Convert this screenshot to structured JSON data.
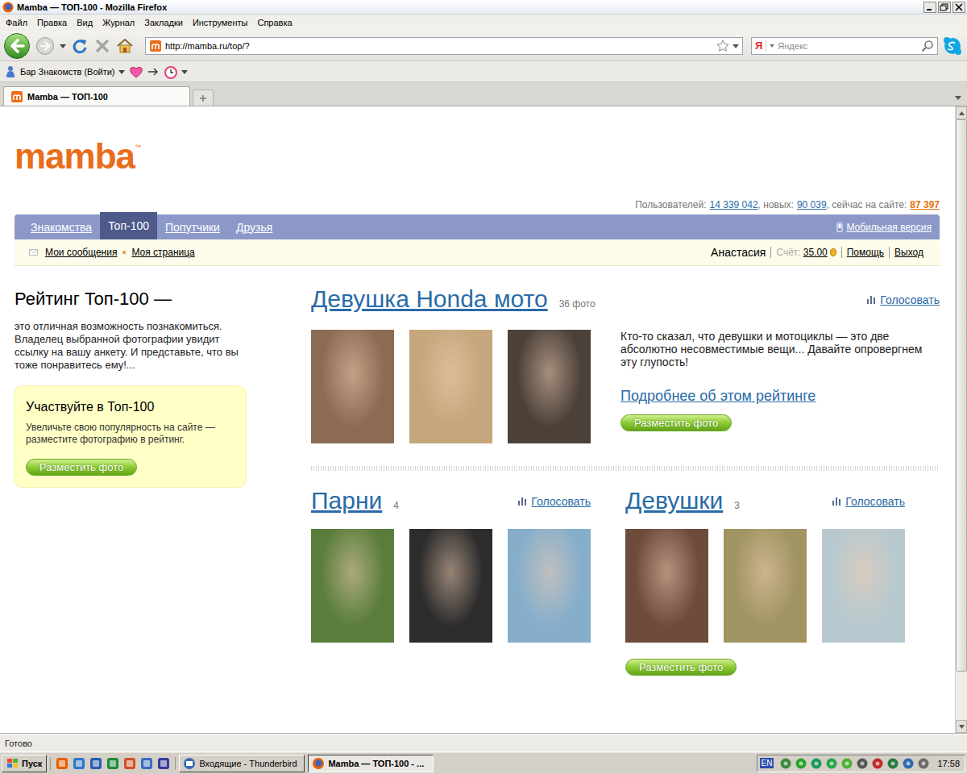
{
  "window": {
    "title": "Mamba — ТОП-100 - Mozilla Firefox"
  },
  "menu": [
    "Файл",
    "Правка",
    "Вид",
    "Журнал",
    "Закладки",
    "Инструменты",
    "Справка"
  ],
  "toolbar": {
    "url": "http://mamba.ru/top/?",
    "search_logo": "Я",
    "search_placeholder": "Яндекс"
  },
  "bookmarks": [
    {
      "label": "Бар Знакомств (Войти)"
    }
  ],
  "tabs": [
    {
      "label": "Mamba — ТОП-100",
      "selected": true
    }
  ],
  "page": {
    "logo": "mamba",
    "logo_tm": "™",
    "stats": [
      {
        "label": "Пользователей:",
        "value": "14 339 042",
        "highlight": false
      },
      {
        "label": ", новых:",
        "value": "90 039",
        "highlight": false
      },
      {
        "label": ", сейчас на сайте:",
        "value": "87 397",
        "highlight": true
      }
    ],
    "nav": [
      {
        "label": "Знакомства",
        "selected": false
      },
      {
        "label": "Топ-100",
        "selected": true
      },
      {
        "label": "Попутчики",
        "selected": false
      },
      {
        "label": "Друзья",
        "selected": false
      }
    ],
    "mobile": "Мобильная версия",
    "subnav": {
      "links": [
        "Мои сообщения",
        "Моя страница"
      ],
      "user": "Анастасия",
      "balance_label": "Счёт:",
      "balance": "35.00",
      "actions": [
        "Помощь",
        "Выход"
      ]
    },
    "sidebar": {
      "title": "Рейтинг Топ-100 —",
      "text": "это отличная возможность познакомиться. Владелец выбранной фотографии увидит ссылку на вашу анкету. И представьте, что вы тоже понравитесь ему!...",
      "promo": {
        "title": "Участвуйте в Топ-100",
        "text": "Увеличьте свою популярность на сайте — разместите фотографию в рейтинг.",
        "button": "Разместить фото"
      }
    },
    "featured": {
      "title": "Девушка Honda мото",
      "count": "36 фото",
      "vote": "Голосовать",
      "photos": [
        {
          "color": "#8b6b54"
        },
        {
          "color": "#c6a67c"
        },
        {
          "color": "#4b4139"
        }
      ],
      "description": "Кто-то сказал, что девушки и мотоциклы — это две абсолютно несовместимые вещи... Давайте опровергнем эту глупость!",
      "more": "Подробнее об этом рейтинге",
      "button": "Разместить фото"
    },
    "ratings": [
      {
        "title": "Парни",
        "count": "4",
        "vote": "Голосовать",
        "photos": [
          {
            "color": "#5a7d3c"
          },
          {
            "color": "#2c2c2c"
          },
          {
            "color": "#86aecb"
          }
        ]
      },
      {
        "title": "Девушки",
        "count": "3",
        "vote": "Голосовать",
        "photos": [
          {
            "color": "#6e4c3c"
          },
          {
            "color": "#a09462"
          },
          {
            "color": "#b7c9cf"
          }
        ],
        "button": "Разместить фото"
      }
    ]
  },
  "scrollbar": {
    "level": 0.92
  },
  "status_bar": "Готово",
  "taskbar": {
    "start": "Пуск",
    "tasks": [
      {
        "label": "Входящие - Thunderbird",
        "selected": false
      },
      {
        "label": "Mamba — ТОП-100 - ...",
        "selected": true
      }
    ],
    "lang": "EN",
    "time": "17:58"
  }
}
